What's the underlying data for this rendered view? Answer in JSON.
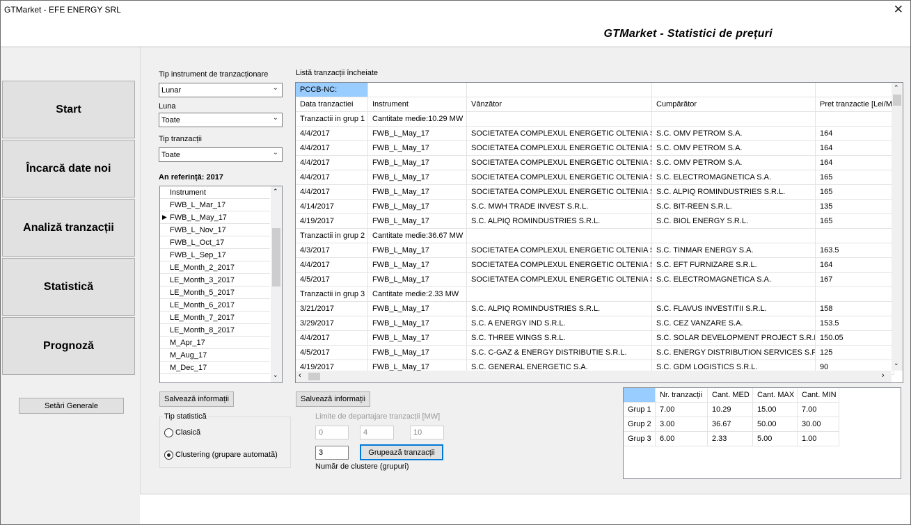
{
  "window": {
    "title": "GTMarket - EFE ENERGY SRL",
    "close": "✕"
  },
  "header": {
    "title": "GTMarket - Statistici de prețuri"
  },
  "nav": {
    "start": "Start",
    "load": "Încarcă date noi",
    "analysis": "Analiză tranzacții",
    "stats": "Statistică",
    "forecast": "Prognoză",
    "settings": "Setări Generale"
  },
  "filters": {
    "instrument_type_label": "Tip instrument de tranzacționare",
    "instrument_type_value": "Lunar",
    "month_label": "Luna",
    "month_value": "Toate",
    "trade_type_label": "Tip tranzacții",
    "trade_type_value": "Toate",
    "ref_year": "An referință: 2017"
  },
  "instruments": {
    "header": "Instrument",
    "selected_marker": "▶",
    "items": [
      "FWB_L_Mar_17",
      "FWB_L_May_17",
      "FWB_L_Nov_17",
      "FWB_L_Oct_17",
      "FWB_L_Sep_17",
      "LE_Month_2_2017",
      "LE_Month_3_2017",
      "LE_Month_5_2017",
      "LE_Month_6_2017",
      "LE_Month_7_2017",
      "LE_Month_8_2017",
      "M_Apr_17",
      "M_Aug_17",
      "M_Dec_17"
    ],
    "selected_index": 1
  },
  "buttons": {
    "save_left": "Salvează informații",
    "save_right": "Salvează informații",
    "group": "Grupează tranzacții"
  },
  "stat_type": {
    "label": "Tip statistică",
    "classic": "Clasică",
    "clustering": "Clustering (grupare automată)"
  },
  "limits": {
    "label": "Limite de departajare tranzacții [MW]",
    "v1": "0",
    "v2": "4",
    "v3": "10",
    "clusters_value": "3",
    "clusters_label": "Număr de clustere (grupuri)"
  },
  "trades": {
    "title": "Listă tranzacții încheiate",
    "market": "PCCB-NC:",
    "headers": [
      "Data tranzactiei",
      "Instrument",
      "Vânzător",
      "Cumpărător",
      "Pret tranzactie [Lei/MWh]"
    ],
    "rows": [
      [
        "Tranzactii in grup 1",
        "Cantitate medie:10.29 MW",
        "",
        "",
        ""
      ],
      [
        "4/4/2017",
        "FWB_L_May_17",
        "SOCIETATEA COMPLEXUL ENERGETIC OLTENIA S.A.",
        "S.C. OMV PETROM S.A.",
        "164"
      ],
      [
        "4/4/2017",
        "FWB_L_May_17",
        "SOCIETATEA COMPLEXUL ENERGETIC OLTENIA S.A.",
        "S.C. OMV PETROM S.A.",
        "164"
      ],
      [
        "4/4/2017",
        "FWB_L_May_17",
        "SOCIETATEA COMPLEXUL ENERGETIC OLTENIA S.A.",
        "S.C. OMV PETROM S.A.",
        "164"
      ],
      [
        "4/4/2017",
        "FWB_L_May_17",
        "SOCIETATEA COMPLEXUL ENERGETIC OLTENIA S.A.",
        "S.C. ELECTROMAGNETICA S.A.",
        "165"
      ],
      [
        "4/4/2017",
        "FWB_L_May_17",
        "SOCIETATEA COMPLEXUL ENERGETIC OLTENIA S.A.",
        "S.C. ALPIQ ROMINDUSTRIES S.R.L.",
        "165"
      ],
      [
        "4/14/2017",
        "FWB_L_May_17",
        "S.C. MWH TRADE INVEST S.R.L.",
        "S.C. BIT-REEN S.R.L.",
        "135"
      ],
      [
        "4/19/2017",
        "FWB_L_May_17",
        "S.C. ALPIQ ROMINDUSTRIES S.R.L.",
        "S.C. BIOL ENERGY S.R.L.",
        "165"
      ],
      [
        "Tranzactii in grup 2",
        "Cantitate medie:36.67 MW",
        "",
        "",
        ""
      ],
      [
        "4/3/2017",
        "FWB_L_May_17",
        "SOCIETATEA COMPLEXUL ENERGETIC OLTENIA S.A.",
        "S.C. TINMAR ENERGY S.A.",
        "163.5"
      ],
      [
        "4/4/2017",
        "FWB_L_May_17",
        "SOCIETATEA COMPLEXUL ENERGETIC OLTENIA S.A.",
        "S.C. EFT FURNIZARE S.R.L.",
        "164"
      ],
      [
        "4/5/2017",
        "FWB_L_May_17",
        "SOCIETATEA COMPLEXUL ENERGETIC OLTENIA S.A.",
        "S.C. ELECTROMAGNETICA S.A.",
        "167"
      ],
      [
        "Tranzactii in grup 3",
        "Cantitate medie:2.33 MW",
        "",
        "",
        ""
      ],
      [
        "3/21/2017",
        "FWB_L_May_17",
        "S.C. ALPIQ ROMINDUSTRIES S.R.L.",
        "S.C. FLAVUS INVESTITII S.R.L.",
        "158"
      ],
      [
        "3/29/2017",
        "FWB_L_May_17",
        "S.C. A ENERGY IND S.R.L.",
        "S.C. CEZ VANZARE S.A.",
        "153.5"
      ],
      [
        "4/4/2017",
        "FWB_L_May_17",
        "S.C. THREE WINGS S.R.L.",
        "S.C. SOLAR DEVELOPMENT PROJECT S.R.L.",
        "150.05"
      ],
      [
        "4/5/2017",
        "FWB_L_May_17",
        "S.C. C-GAZ & ENERGY DISTRIBUTIE S.R.L.",
        "S.C. ENERGY DISTRIBUTION SERVICES S.R.L.",
        "125"
      ],
      [
        "4/19/2017",
        "FWB_L_May_17",
        "S.C. GENERAL ENERGETIC S.A.",
        "S.C. GDM LOGISTICS S.R.L.",
        "90"
      ]
    ]
  },
  "summary": {
    "headers": [
      "",
      "Nr. tranzacții",
      "Cant. MED",
      "Cant. MAX",
      "Cant. MIN"
    ],
    "rows": [
      [
        "Grup 1",
        "7.00",
        "10.29",
        "15.00",
        "7.00"
      ],
      [
        "Grup 2",
        "3.00",
        "36.67",
        "50.00",
        "30.00"
      ],
      [
        "Grup 3",
        "6.00",
        "2.33",
        "5.00",
        "1.00"
      ]
    ]
  },
  "colors": {
    "highlight": "#99ccff"
  }
}
